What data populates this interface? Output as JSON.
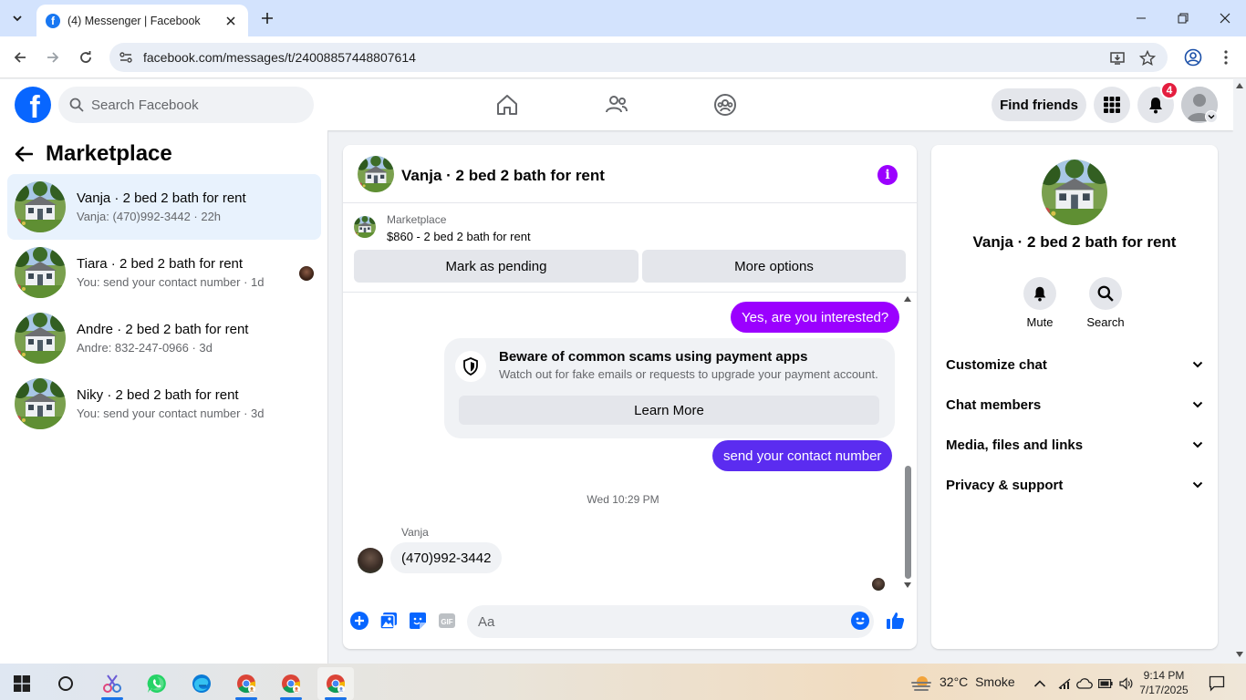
{
  "browser": {
    "tab_title": "(4) Messenger | Facebook",
    "url": "facebook.com/messages/t/24008857448807614"
  },
  "fb_header": {
    "search_placeholder": "Search Facebook",
    "find_friends_label": "Find friends",
    "notification_count": "4"
  },
  "sidebar": {
    "title": "Marketplace",
    "conversations": [
      {
        "name": "Vanja · 2 bed 2 bath for rent",
        "preview": "Vanja: (470)992-3442 · 22h",
        "active": true
      },
      {
        "name": "Tiara · 2 bed 2 bath for rent",
        "preview": "You: send your contact number · 1d",
        "active": false
      },
      {
        "name": "Andre · 2 bed 2 bath for rent",
        "preview": "Andre: 832-247-0966 · 3d",
        "active": false
      },
      {
        "name": "Niky · 2 bed 2 bath for rent",
        "preview": "You: send your contact number · 3d",
        "active": false
      }
    ]
  },
  "chat": {
    "title": "Vanja · 2 bed 2 bath for rent",
    "listing": {
      "label": "Marketplace",
      "price_title": "$860 - 2 bed 2 bath for rent",
      "mark_pending_label": "Mark as pending",
      "more_options_label": "More options"
    },
    "messages": {
      "out_1": "Yes, are you interested?",
      "scam_title": "Beware of common scams using payment apps",
      "scam_body": "Watch out for fake emails or requests to upgrade your payment account.",
      "learn_more_label": "Learn More",
      "out_2": "send your contact number",
      "timestamp": "Wed 10:29 PM",
      "sender_name": "Vanja",
      "in_1": "(470)992-3442"
    },
    "composer_placeholder": "Aa",
    "colors": {
      "bubble_1": "#9b00ff",
      "bubble_2": "#5b2cf0",
      "accent": "#0866ff"
    }
  },
  "info_panel": {
    "title": "Vanja · 2 bed 2 bath for rent",
    "actions": [
      {
        "label": "Mute"
      },
      {
        "label": "Search"
      }
    ],
    "rows": [
      {
        "label": "Customize chat"
      },
      {
        "label": "Chat members"
      },
      {
        "label": "Media, files and links"
      },
      {
        "label": "Privacy & support"
      }
    ]
  },
  "taskbar": {
    "weather_temp": "32°C",
    "weather_desc": "Smoke",
    "time": "9:14 PM",
    "date": "7/17/2025"
  }
}
